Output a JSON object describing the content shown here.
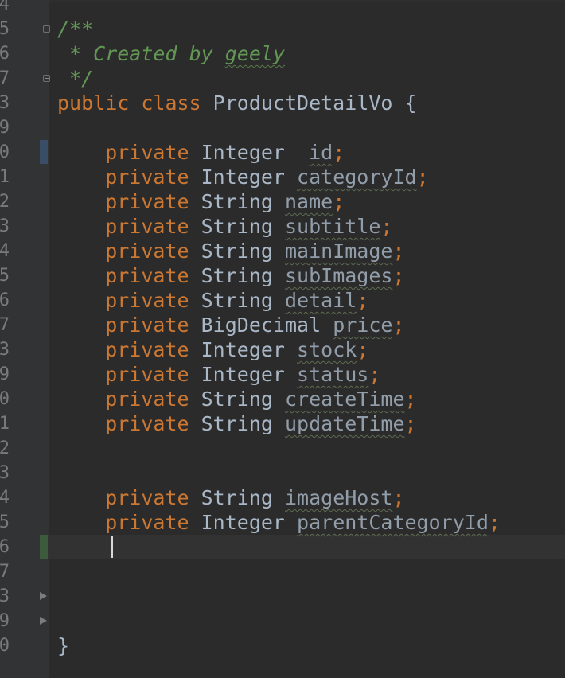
{
  "colors": {
    "background": "#2b2b2b",
    "gutter": "#313335",
    "keyword": "#cc7832",
    "comment": "#629755",
    "text": "#a9b7c6",
    "gutter_change_blue": "#3a4d66",
    "gutter_change_green": "#3d5a3d"
  },
  "gutter": {
    "line_digits": [
      "4",
      "5",
      "6",
      "7",
      "3",
      "9",
      "0",
      "1",
      "2",
      "3",
      "4",
      "5",
      "6",
      "7",
      "3",
      "9",
      "0",
      "1",
      "2",
      "3",
      "4",
      "5",
      "6",
      "7",
      "3",
      "9",
      "0"
    ]
  },
  "code": {
    "lines": [
      {
        "tokens": []
      },
      {
        "tokens": [
          {
            "t": "comment",
            "v": "/**"
          }
        ]
      },
      {
        "tokens": [
          {
            "t": "comment",
            "v": " * Created by "
          },
          {
            "t": "author",
            "v": "geely"
          }
        ]
      },
      {
        "tokens": [
          {
            "t": "comment",
            "v": " */"
          }
        ]
      },
      {
        "tokens": [
          {
            "t": "kw",
            "v": "public class "
          },
          {
            "t": "plain",
            "v": "ProductDetailVo {"
          }
        ]
      },
      {
        "tokens": []
      },
      {
        "tokens": [
          {
            "t": "kw",
            "v": "    private "
          },
          {
            "t": "type",
            "v": "Integer  "
          },
          {
            "t": "field",
            "v": "id"
          },
          {
            "t": "semi",
            "v": ";"
          }
        ]
      },
      {
        "tokens": [
          {
            "t": "kw",
            "v": "    private "
          },
          {
            "t": "type",
            "v": "Integer "
          },
          {
            "t": "field",
            "v": "categoryId"
          },
          {
            "t": "semi",
            "v": ";"
          }
        ]
      },
      {
        "tokens": [
          {
            "t": "kw",
            "v": "    private "
          },
          {
            "t": "type",
            "v": "String "
          },
          {
            "t": "field",
            "v": "name"
          },
          {
            "t": "semi",
            "v": ";"
          }
        ]
      },
      {
        "tokens": [
          {
            "t": "kw",
            "v": "    private "
          },
          {
            "t": "type",
            "v": "String "
          },
          {
            "t": "field",
            "v": "subtitle"
          },
          {
            "t": "semi",
            "v": ";"
          }
        ]
      },
      {
        "tokens": [
          {
            "t": "kw",
            "v": "    private "
          },
          {
            "t": "type",
            "v": "String "
          },
          {
            "t": "field",
            "v": "mainImage"
          },
          {
            "t": "semi",
            "v": ";"
          }
        ]
      },
      {
        "tokens": [
          {
            "t": "kw",
            "v": "    private "
          },
          {
            "t": "type",
            "v": "String "
          },
          {
            "t": "field",
            "v": "subImages"
          },
          {
            "t": "semi",
            "v": ";"
          }
        ]
      },
      {
        "tokens": [
          {
            "t": "kw",
            "v": "    private "
          },
          {
            "t": "type",
            "v": "String "
          },
          {
            "t": "field",
            "v": "detail"
          },
          {
            "t": "semi",
            "v": ";"
          }
        ]
      },
      {
        "tokens": [
          {
            "t": "kw",
            "v": "    private "
          },
          {
            "t": "type",
            "v": "BigDecimal "
          },
          {
            "t": "field",
            "v": "price"
          },
          {
            "t": "semi",
            "v": ";"
          }
        ]
      },
      {
        "tokens": [
          {
            "t": "kw",
            "v": "    private "
          },
          {
            "t": "type",
            "v": "Integer "
          },
          {
            "t": "field",
            "v": "stock"
          },
          {
            "t": "semi",
            "v": ";"
          }
        ]
      },
      {
        "tokens": [
          {
            "t": "kw",
            "v": "    private "
          },
          {
            "t": "type",
            "v": "Integer "
          },
          {
            "t": "field",
            "v": "status"
          },
          {
            "t": "semi",
            "v": ";"
          }
        ]
      },
      {
        "tokens": [
          {
            "t": "kw",
            "v": "    private "
          },
          {
            "t": "type",
            "v": "String "
          },
          {
            "t": "field",
            "v": "createTime"
          },
          {
            "t": "semi",
            "v": ";"
          }
        ]
      },
      {
        "tokens": [
          {
            "t": "kw",
            "v": "    private "
          },
          {
            "t": "type",
            "v": "String "
          },
          {
            "t": "field",
            "v": "updateTime"
          },
          {
            "t": "semi",
            "v": ";"
          }
        ]
      },
      {
        "tokens": []
      },
      {
        "tokens": []
      },
      {
        "tokens": [
          {
            "t": "kw",
            "v": "    private "
          },
          {
            "t": "type",
            "v": "String "
          },
          {
            "t": "field",
            "v": "imageHost"
          },
          {
            "t": "semi",
            "v": ";"
          }
        ]
      },
      {
        "tokens": [
          {
            "t": "kw",
            "v": "    private "
          },
          {
            "t": "type",
            "v": "Integer "
          },
          {
            "t": "field",
            "v": "parentCategoryId"
          },
          {
            "t": "semi",
            "v": ";"
          }
        ]
      },
      {
        "tokens": []
      },
      {
        "tokens": []
      },
      {
        "tokens": []
      },
      {
        "tokens": []
      },
      {
        "tokens": [
          {
            "t": "plain",
            "v": "}"
          }
        ]
      }
    ],
    "caret_line_index": 22
  }
}
